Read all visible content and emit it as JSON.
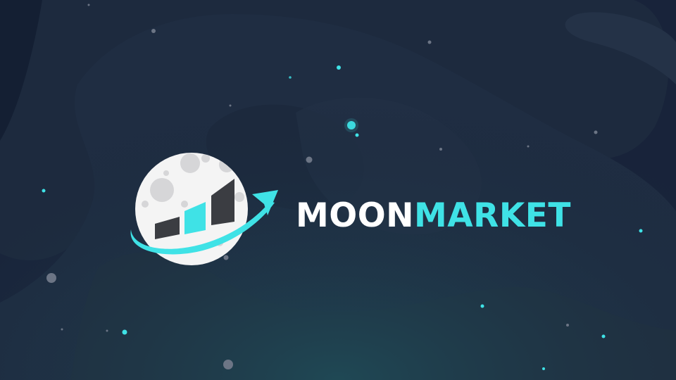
{
  "logo": {
    "word_primary": "MOON",
    "word_accent": "MARKET",
    "icon": "moon-rising-chart-icon"
  },
  "colors": {
    "background": "#1a2638",
    "text_primary": "#ffffff",
    "accent": "#3fe2e6",
    "moon": "#f4f4f4",
    "bars_dark": "#3b3d42"
  }
}
